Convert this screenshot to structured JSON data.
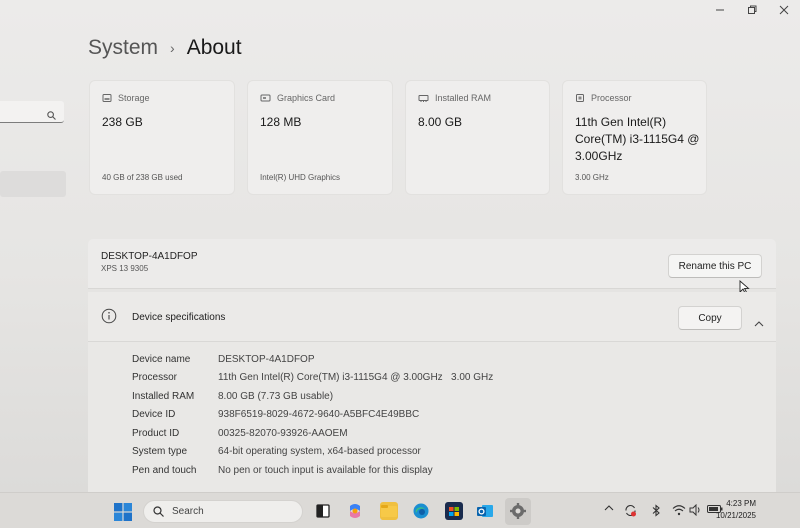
{
  "window": {
    "breadcrumb_parent": "System",
    "breadcrumb_separator": "›",
    "breadcrumb_current": "About"
  },
  "cards": [
    {
      "label": "Storage",
      "value": "238 GB",
      "sub": "40 GB of 238 GB used",
      "icon": "storage-icon"
    },
    {
      "label": "Graphics Card",
      "value": "128 MB",
      "sub": "Intel(R) UHD Graphics",
      "icon": "graphics-card-icon"
    },
    {
      "label": "Installed RAM",
      "value": "8.00 GB",
      "sub": "",
      "icon": "ram-icon"
    },
    {
      "label": "Processor",
      "value": "11th Gen Intel(R) Core(TM) i3-1115G4 @ 3.00GHz",
      "sub": "3.00 GHz",
      "icon": "processor-icon"
    }
  ],
  "pc": {
    "name": "DESKTOP-4A1DFOP",
    "model": "XPS 13 9305",
    "rename_label": "Rename this PC"
  },
  "specs": {
    "title": "Device specifications",
    "copy_label": "Copy",
    "rows": [
      {
        "k": "Device name",
        "v": "DESKTOP-4A1DFOP"
      },
      {
        "k": "Processor",
        "v": "11th Gen Intel(R) Core(TM) i3-1115G4 @ 3.00GHz   3.00 GHz"
      },
      {
        "k": "Installed RAM",
        "v": "8.00 GB (7.73 GB usable)"
      },
      {
        "k": "Device ID",
        "v": "938F6519-8029-4672-9640-A5BFC4E49BBC"
      },
      {
        "k": "Product ID",
        "v": "00325-82070-93926-AAOEM"
      },
      {
        "k": "System type",
        "v": "64-bit operating system, x64-based processor"
      },
      {
        "k": "Pen and touch",
        "v": "No pen or touch input is available for this display"
      }
    ]
  },
  "taskbar": {
    "search_label": "Search",
    "time": "4:23 PM",
    "date": "10/21/2025"
  },
  "colors": {
    "accent": "#0067c0",
    "window_bg": "#ecebea",
    "card_bg": "#efeeed",
    "taskbar_bg": "#dcdad7"
  }
}
